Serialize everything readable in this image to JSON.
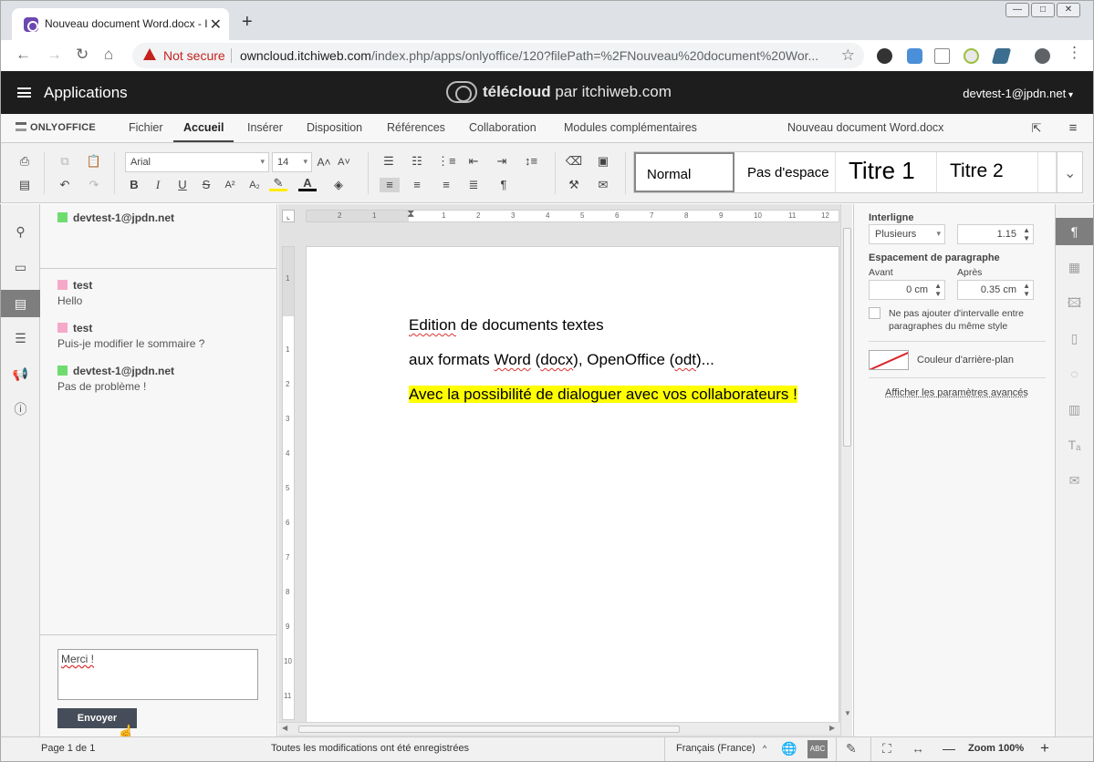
{
  "browser": {
    "tab_title": "Nouveau document Word.docx - Itc",
    "tab_close": "✕",
    "new_tab": "+",
    "security_label": "Not secure",
    "url_host": "owncloud.itchiweb.com",
    "url_path": "/index.php/apps/onlyoffice/120?filePath=%2FNouveau%20document%20Wor...",
    "window_controls": [
      "—",
      "□",
      "✕"
    ]
  },
  "owncloud": {
    "apps_label": "Applications",
    "brand_bold": "télécloud",
    "brand_rest": " par itchiweb.com",
    "user": "devtest-1@jpdn.net"
  },
  "editor": {
    "logo": "ONLYOFFICE",
    "menu": [
      "Fichier",
      "Accueil",
      "Insérer",
      "Disposition",
      "Références",
      "Collaboration",
      "Modules complémentaires"
    ],
    "active_menu": "Accueil",
    "document_name": "Nouveau document Word.docx"
  },
  "toolbar": {
    "font_name": "Arial",
    "font_size": "14",
    "grow_font": "A˄",
    "shrink_font": "A˅",
    "bold": "B",
    "italic": "I",
    "underline": "U",
    "strike": "S",
    "superscript": "A²",
    "subscript": "A₂",
    "paragraph_mark": "¶",
    "styles": [
      "Normal",
      "Pas d'espace",
      "Titre 1",
      "Titre 2"
    ]
  },
  "chat": {
    "online_user": "devtest-1@jpdn.net",
    "online_user_color": "#6fdc6f",
    "messages": [
      {
        "author": "test",
        "color": "#f5a9c9",
        "text": "Hello"
      },
      {
        "author": "test",
        "color": "#f5a9c9",
        "text": "Puis-je modifier le sommaire ?"
      },
      {
        "author": "devtest-1@jpdn.net",
        "color": "#6fdc6f",
        "text": "Pas de problème !"
      }
    ],
    "input_value": "Merci !",
    "send_label": "Envoyer"
  },
  "document": {
    "line1_underlined": "Edition",
    "line1_rest": " de documents textes",
    "line2_parts": [
      "aux formats ",
      "Word",
      " (",
      "docx",
      "), OpenOffice (",
      "odt",
      ")..."
    ],
    "line3": "Avec la possibilité de dialoguer avec vos collaborateurs !",
    "highlight_color": "#ffff00",
    "ruler_h": [
      "2",
      "1",
      "1",
      "2",
      "3",
      "4",
      "5",
      "6",
      "7",
      "8",
      "9",
      "10",
      "11",
      "12"
    ],
    "ruler_v": [
      "1",
      "1",
      "2",
      "3",
      "4",
      "5",
      "6",
      "7",
      "8",
      "9",
      "10",
      "11"
    ]
  },
  "paragraph_settings": {
    "line_spacing_label": "Interligne",
    "line_spacing_mode": "Plusieurs",
    "line_spacing_value": "1.15",
    "spacing_label": "Espacement de paragraphe",
    "before_label": "Avant",
    "before_value": "0 cm",
    "after_label": "Après",
    "after_value": "0.35 cm",
    "no_interval_label": "Ne pas ajouter d'intervalle entre paragraphes du même style",
    "background_label": "Couleur d'arrière-plan",
    "advanced_link": "Afficher les paramètres avancés"
  },
  "statusbar": {
    "page": "Page 1 de 1",
    "save_status": "Toutes les modifications ont été enregistrées",
    "language": "Français (France)",
    "spell_icon": "ABC",
    "zoom": "Zoom 100%",
    "zoom_out": "—",
    "zoom_in": "+"
  }
}
